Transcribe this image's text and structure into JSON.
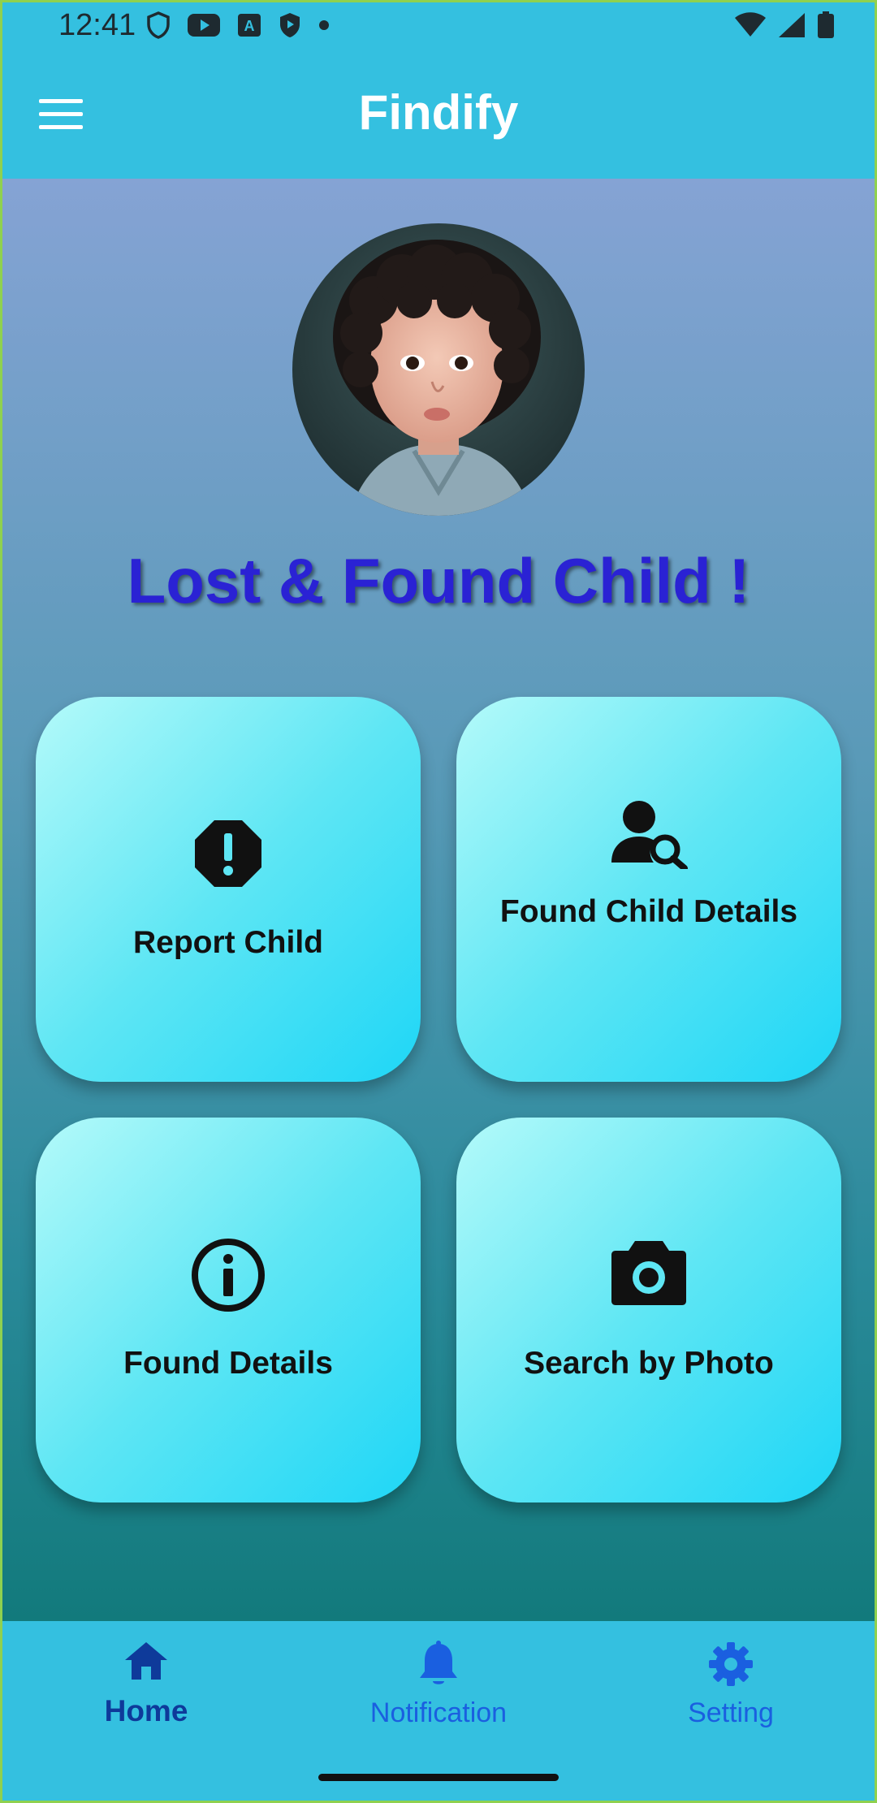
{
  "status_bar": {
    "time": "12:41",
    "left_icons": [
      "shield-outline-icon",
      "youtube-icon",
      "text-a-icon",
      "shield-play-icon",
      "dot-icon"
    ],
    "right_icons": [
      "wifi-icon",
      "cell-signal-icon",
      "battery-icon"
    ]
  },
  "app_bar": {
    "title": "Findify",
    "menu_icon": "hamburger-menu-icon"
  },
  "hero": {
    "image_alt": "child photo",
    "headline": "Lost & Found Child !"
  },
  "cards": [
    {
      "label": "Report Child",
      "icon": "alert-octagon-icon"
    },
    {
      "label": "Found Child Details",
      "icon": "person-search-icon"
    },
    {
      "label": "Found Details",
      "icon": "info-circle-icon"
    },
    {
      "label": "Search by Photo",
      "icon": "camera-icon"
    }
  ],
  "bottom_nav": {
    "items": [
      {
        "label": "Home",
        "icon": "home-icon",
        "active": true
      },
      {
        "label": "Notification",
        "icon": "bell-icon",
        "active": false
      },
      {
        "label": "Setting",
        "icon": "gear-icon",
        "active": false
      }
    ]
  },
  "colors": {
    "bar": "#34c0e0",
    "headline": "#2a22d4",
    "card_start": "#b4fafa",
    "card_end": "#1ed6f6",
    "nav_active": "#0e3a9a",
    "nav_inactive": "#1a5fe0"
  }
}
